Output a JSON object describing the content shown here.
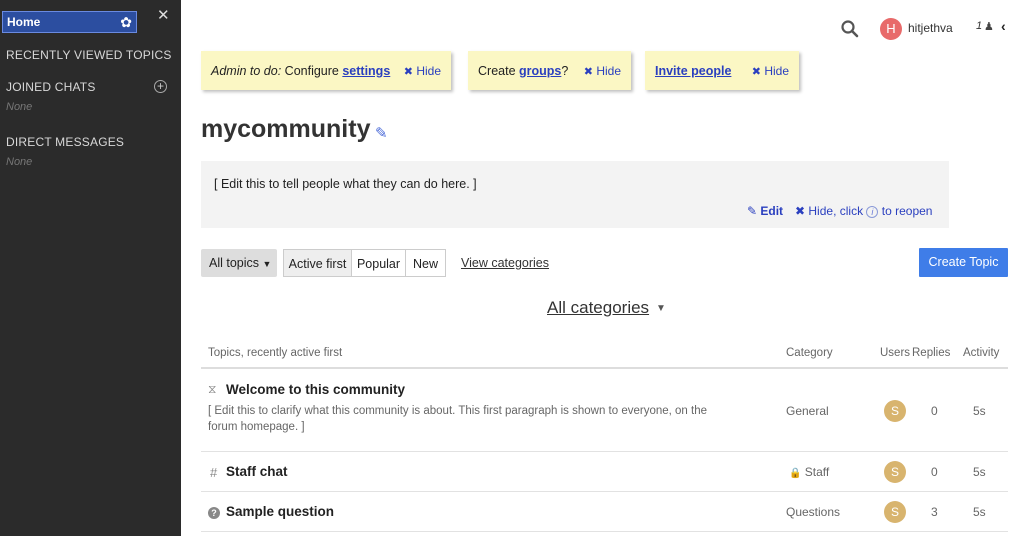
{
  "sidebar": {
    "home_label": "Home",
    "recently_viewed": "RECENTLY VIEWED TOPICS",
    "joined_chats": "JOINED CHATS",
    "joined_none": "None",
    "direct_messages": "DIRECT MESSAGES",
    "direct_none": "None"
  },
  "topbar": {
    "avatar_letter": "H",
    "username": "hitjethva",
    "notif": "1"
  },
  "notes": {
    "admin_prefix": "Admin to do:",
    "admin_text": " Configure ",
    "admin_link": "settings",
    "groups_prefix": "Create ",
    "groups_link": "groups",
    "groups_suffix": "?",
    "invite_link": "Invite people",
    "hide_label": "Hide"
  },
  "page": {
    "title": "mycommunity",
    "intro": "[ Edit this to tell people what they can do here. ]",
    "edit": "Edit",
    "hide_click": "Hide, click",
    "to_reopen": "to reopen"
  },
  "filters": {
    "all_topics": "All topics",
    "active_first": "Active first",
    "popular": "Popular",
    "new": "New",
    "view_categories": "View categories",
    "create_topic": "Create Topic",
    "all_categories": "All categories"
  },
  "table": {
    "headers": {
      "topics": "Topics, recently active first",
      "category": "Category",
      "users": "Users",
      "replies": "Replies",
      "activity": "Activity"
    },
    "rows": [
      {
        "title": "Welcome to this community",
        "excerpt": "[ Edit this to clarify what this community is about. This first paragraph is shown to everyone, on the forum homepage. ]",
        "category": "General",
        "user": "S",
        "replies": "0",
        "activity": "5s"
      },
      {
        "title": "Staff chat",
        "category": "Staff",
        "user": "S",
        "replies": "0",
        "activity": "5s"
      },
      {
        "title": "Sample question",
        "category": "Questions",
        "user": "S",
        "replies": "3",
        "activity": "5s"
      }
    ]
  },
  "colors": {
    "sidebar_bg": "#2b2b2b",
    "home_highlight": "#2c4ea0",
    "note_bg": "#fbf7c4",
    "link_blue": "#2a3fbf",
    "primary_button": "#3f7de8",
    "avatar_user": "#e86a6a",
    "avatar_author": "#d8b46e"
  }
}
